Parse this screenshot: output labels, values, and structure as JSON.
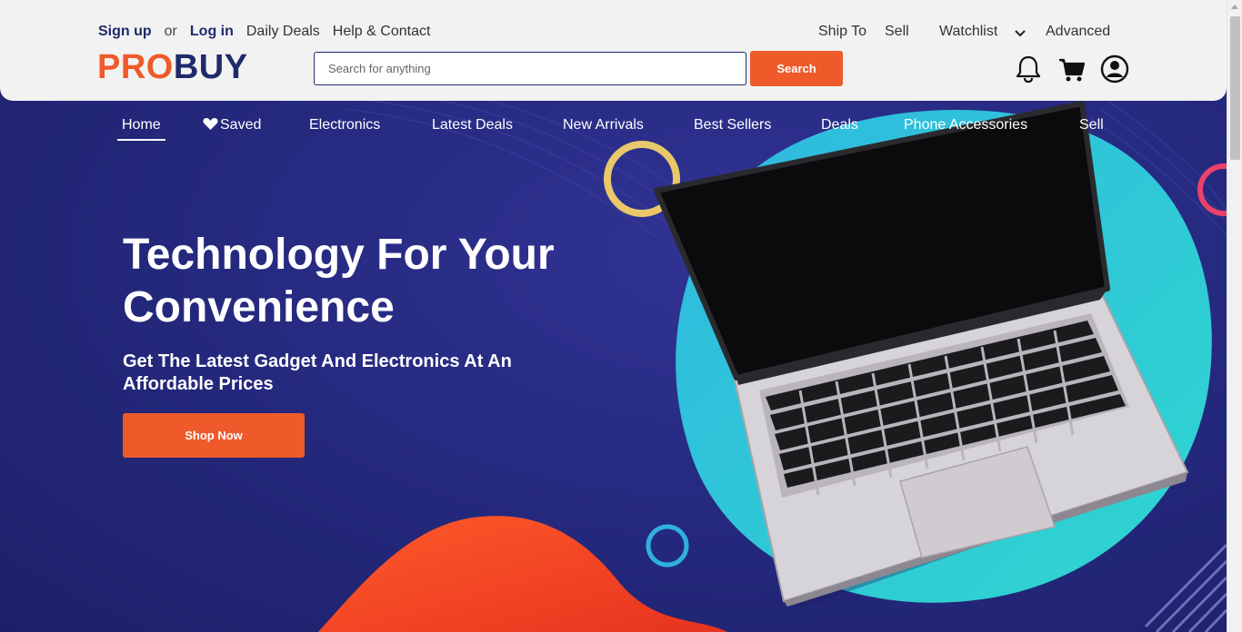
{
  "header": {
    "sign_up": "Sign up",
    "or": "or",
    "log_in": "Log in",
    "daily_deals": "Daily Deals",
    "help_contact": "Help & Contact",
    "ship_to": "Ship To",
    "sell": "Sell",
    "watchlist": "Watchlist",
    "advanced": "Advanced",
    "logo_pro": "PRO",
    "logo_buy": "BUY"
  },
  "search": {
    "placeholder": "Search for anything",
    "button_label": "Search"
  },
  "icons": [
    "bell-icon",
    "cart-icon",
    "user-account-icon",
    "heart-icon",
    "chevron-down-icon"
  ],
  "nav": {
    "home": "Home",
    "saved": "Saved",
    "electronics": "Electronics",
    "latest_deals": "Latest Deals",
    "new_arrivals": "New Arrivals",
    "best_sellers": "Best Sellers",
    "deals": "Deals",
    "phone_accessories": "Phone Accessories",
    "sell": "Sell"
  },
  "hero": {
    "title": "Technology For Your Convenience",
    "subtitle": "Get The Latest Gadget And Electronics At An Affordable Prices",
    "cta_label": "Shop Now"
  },
  "colors": {
    "brand_orange": "#ef5a2a",
    "brand_navy": "#1f2a6b",
    "hero_bg": "#262a80",
    "accent_teal": "#2ec4d6",
    "accent_yellow": "#e8c86a"
  }
}
